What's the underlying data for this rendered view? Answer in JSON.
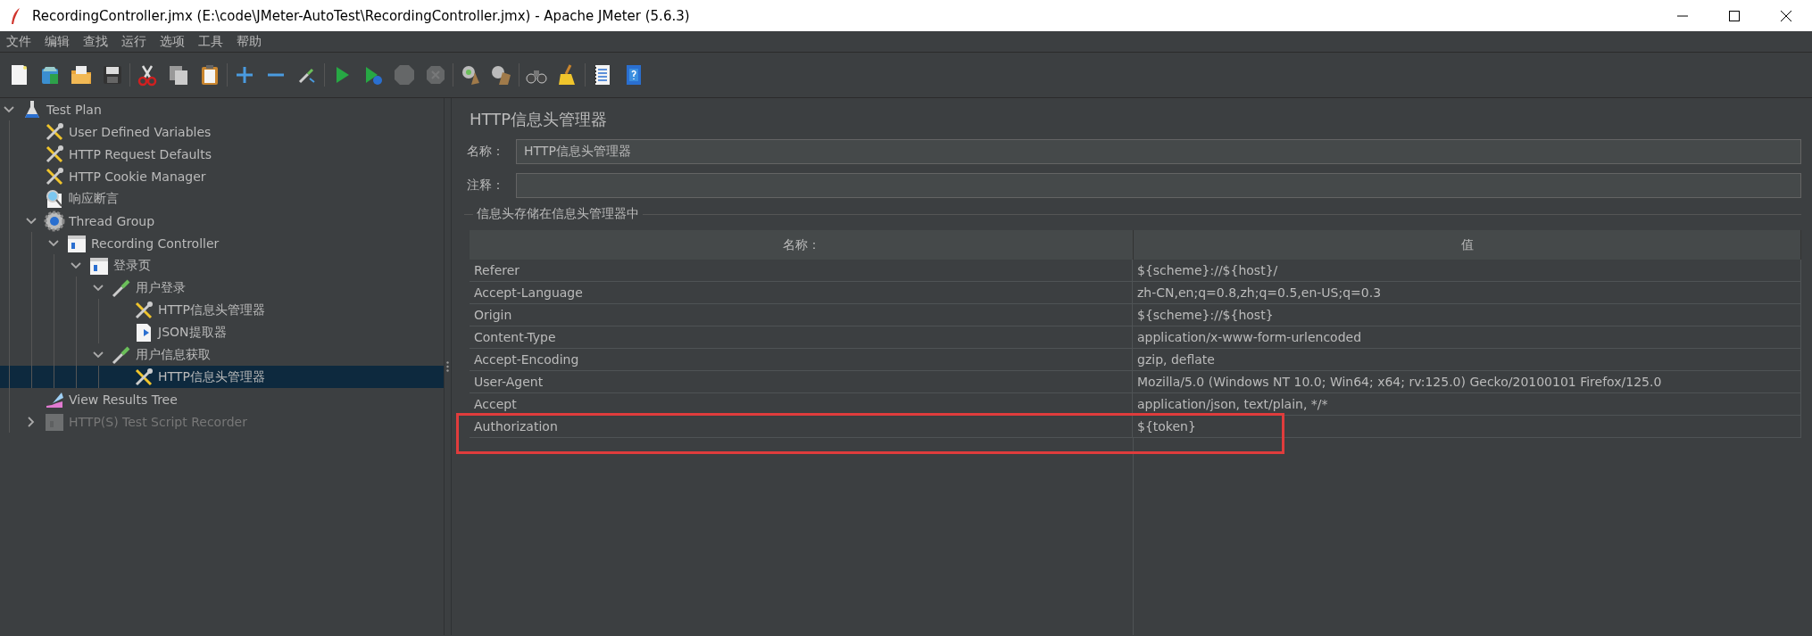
{
  "window": {
    "title": "RecordingController.jmx (E:\\code\\JMeter-AutoTest\\RecordingController.jmx) - Apache JMeter (5.6.3)"
  },
  "menu": [
    "文件",
    "编辑",
    "查找",
    "运行",
    "选项",
    "工具",
    "帮助"
  ],
  "toolbar": [
    [
      {
        "kind": "new",
        "disabled": false
      },
      {
        "kind": "templates",
        "disabled": false
      },
      {
        "kind": "open",
        "disabled": false
      },
      {
        "kind": "save",
        "disabled": false
      }
    ],
    [
      {
        "kind": "cut",
        "disabled": false
      },
      {
        "kind": "copy",
        "disabled": false
      },
      {
        "kind": "paste",
        "disabled": false
      }
    ],
    [
      {
        "kind": "expand",
        "disabled": false
      },
      {
        "kind": "collapse",
        "disabled": false
      },
      {
        "kind": "toggle",
        "disabled": false
      }
    ],
    [
      {
        "kind": "start",
        "disabled": false
      },
      {
        "kind": "start-no-pause",
        "disabled": false
      },
      {
        "kind": "stop",
        "disabled": true
      },
      {
        "kind": "shutdown",
        "disabled": true
      }
    ],
    [
      {
        "kind": "clear",
        "disabled": false
      },
      {
        "kind": "clear-all",
        "disabled": false
      }
    ],
    [
      {
        "kind": "search",
        "disabled": false
      },
      {
        "kind": "reset-search",
        "disabled": false
      }
    ],
    [
      {
        "kind": "function-helper",
        "disabled": false
      },
      {
        "kind": "help",
        "disabled": false
      }
    ]
  ],
  "tree": [
    {
      "label": "Test Plan",
      "kind": "plan",
      "expanded": true,
      "selected": false,
      "disabled": false,
      "children": [
        {
          "label": "User Defined Variables",
          "kind": "config",
          "selected": false,
          "disabled": false
        },
        {
          "label": "HTTP Request Defaults",
          "kind": "config",
          "selected": false,
          "disabled": false
        },
        {
          "label": "HTTP Cookie Manager",
          "kind": "config",
          "selected": false,
          "disabled": false
        },
        {
          "label": "响应断言",
          "kind": "assertion",
          "selected": false,
          "disabled": false
        },
        {
          "label": "Thread Group",
          "kind": "threads",
          "expanded": true,
          "selected": false,
          "disabled": false,
          "children": [
            {
              "label": "Recording Controller",
              "kind": "controller",
              "expanded": true,
              "selected": false,
              "disabled": false,
              "children": [
                {
                  "label": "登录页",
                  "kind": "controller",
                  "expanded": true,
                  "selected": false,
                  "disabled": false,
                  "children": [
                    {
                      "label": "用户登录",
                      "kind": "sampler",
                      "expanded": true,
                      "selected": false,
                      "disabled": false,
                      "children": [
                        {
                          "label": "HTTP信息头管理器",
                          "kind": "config",
                          "selected": false,
                          "disabled": false
                        },
                        {
                          "label": "JSON提取器",
                          "kind": "extractor",
                          "selected": false,
                          "disabled": false
                        }
                      ]
                    },
                    {
                      "label": "用户信息获取",
                      "kind": "sampler",
                      "expanded": true,
                      "selected": false,
                      "disabled": false,
                      "children": [
                        {
                          "label": "HTTP信息头管理器",
                          "kind": "config",
                          "selected": true,
                          "disabled": false
                        }
                      ]
                    }
                  ]
                }
              ]
            }
          ]
        },
        {
          "label": "View Results Tree",
          "kind": "listener",
          "selected": false,
          "disabled": false
        },
        {
          "label": "HTTP(S) Test Script Recorder",
          "kind": "recorder",
          "expanded": false,
          "selected": false,
          "disabled": true
        }
      ]
    }
  ],
  "editor": {
    "title": "HTTP信息头管理器",
    "name_label": "名称：",
    "name_value": "HTTP信息头管理器",
    "comment_label": "注释：",
    "group_title": "信息头存储在信息头管理器中",
    "table": {
      "columns": [
        "名称：",
        "值"
      ],
      "rows": [
        {
          "name": "Referer",
          "value": "${scheme}://${host}/",
          "highlighted": false
        },
        {
          "name": "Accept-Language",
          "value": "zh-CN,en;q=0.8,zh;q=0.5,en-US;q=0.3",
          "highlighted": false
        },
        {
          "name": "Origin",
          "value": "${scheme}://${host}",
          "highlighted": false
        },
        {
          "name": "Content-Type",
          "value": "application/x-www-form-urlencoded",
          "highlighted": false
        },
        {
          "name": "Accept-Encoding",
          "value": "gzip, deflate",
          "highlighted": false
        },
        {
          "name": "User-Agent",
          "value": "Mozilla/5.0 (Windows NT 10.0; Win64; x64; rv:125.0) Gecko/20100101 Firefox/125.0",
          "highlighted": false
        },
        {
          "name": "Accept",
          "value": "application/json, text/plain, */*",
          "highlighted": false
        },
        {
          "name": "Authorization",
          "value": "${token}",
          "highlighted": true
        }
      ]
    }
  }
}
